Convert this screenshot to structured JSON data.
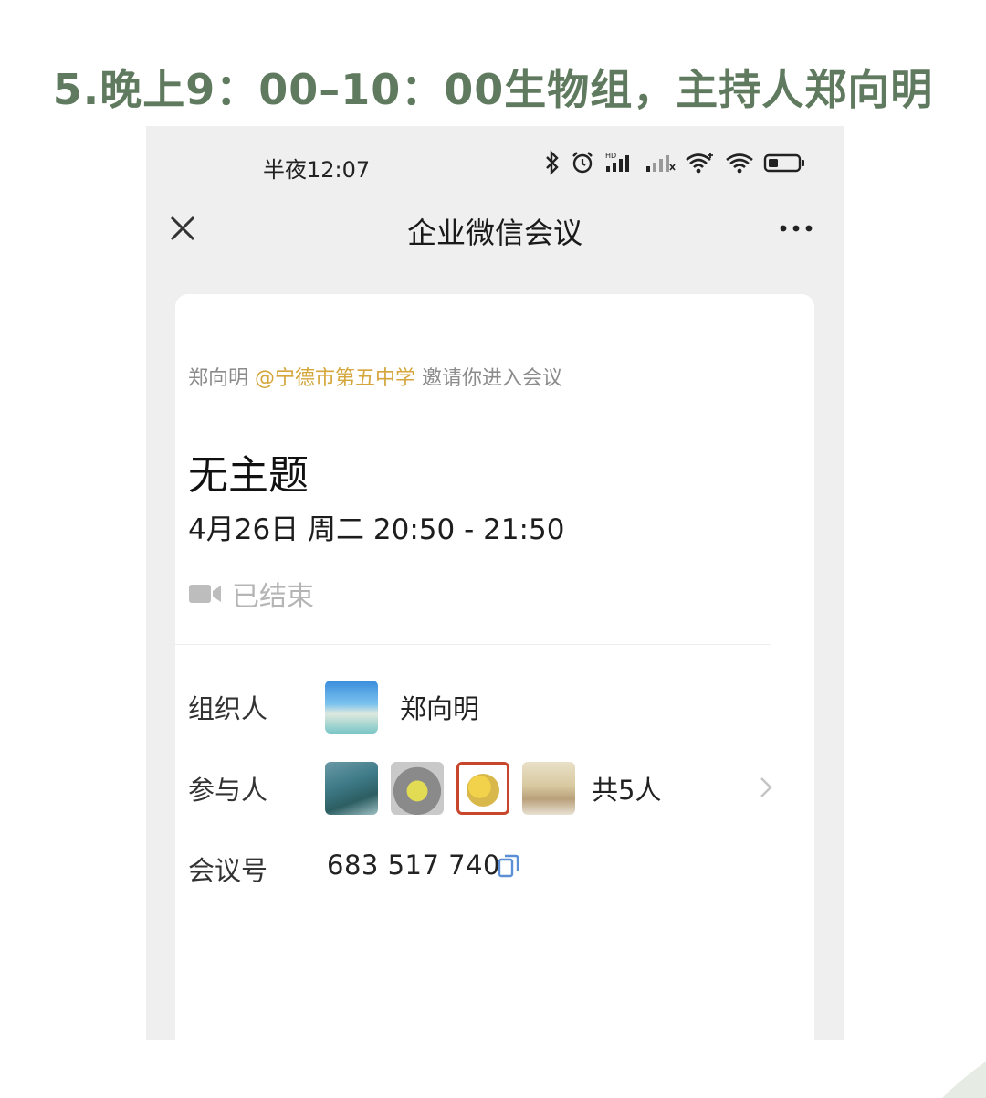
{
  "caption": "5.晚上9：00–10：00生物组，主持人郑向明",
  "status_bar": {
    "time": "半夜12:07",
    "icons": [
      "bluetooth-icon",
      "alarm-icon",
      "hd-signal-icon",
      "signal-weak-icon",
      "wifi-plus-icon",
      "wifi-icon",
      "battery-icon"
    ]
  },
  "nav": {
    "title": "企业微信会议",
    "close_icon": "close-icon",
    "more_icon": "more-icon"
  },
  "meeting": {
    "inviter": "郑向明",
    "organization": "@宁德市第五中学",
    "invite_text": "邀请你进入会议",
    "title": "无主题",
    "time": "4月26日 周二 20:50 - 21:50",
    "status": "已结束"
  },
  "details": {
    "organizer_label": "组织人",
    "organizer_name": "郑向明",
    "participants_label": "参与人",
    "participants_count": "共5人",
    "meeting_number_label": "会议号",
    "meeting_number": "683 517 740"
  },
  "colors": {
    "caption": "#5f7a5e",
    "organization": "#d4a63c",
    "copy_icon": "#5b8fd6",
    "muted": "#b5b5b5"
  }
}
